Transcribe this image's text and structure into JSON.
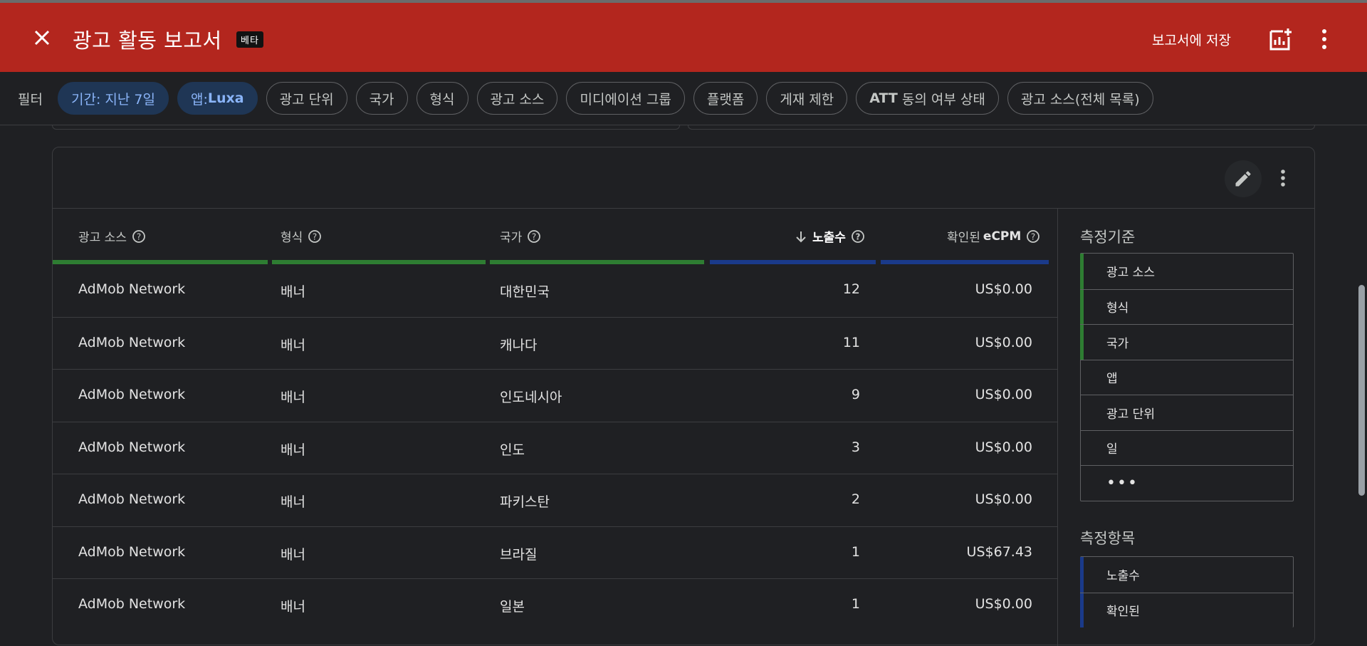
{
  "header": {
    "title": "광고 활동 보고서",
    "badge": "베타",
    "save_label": "보고서에 저장"
  },
  "filters": {
    "label": "필터",
    "chips": [
      {
        "label": "기간: 지난 7일",
        "active": true
      },
      {
        "label": "앱: Luxa",
        "active": true
      },
      {
        "label": "광고 단위",
        "active": false
      },
      {
        "label": "국가",
        "active": false
      },
      {
        "label": "형식",
        "active": false
      },
      {
        "label": "광고 소스",
        "active": false
      },
      {
        "label": "미디에이션 그룹",
        "active": false
      },
      {
        "label": "플랫폼",
        "active": false
      },
      {
        "label": "게재 제한",
        "active": false
      },
      {
        "label": "ATT 동의 여부 상태",
        "active": false
      },
      {
        "label": "광고 소스(전체 목록)",
        "active": false
      }
    ]
  },
  "table": {
    "columns": [
      {
        "label": "광고 소스",
        "type": "dimension"
      },
      {
        "label": "형식",
        "type": "dimension"
      },
      {
        "label": "국가",
        "type": "dimension"
      },
      {
        "label": "노출수",
        "type": "metric",
        "sorted": "desc"
      },
      {
        "label": "확인된",
        "label_bold": "eCPM",
        "type": "metric"
      }
    ],
    "rows": [
      [
        "AdMob Network",
        "배너",
        "대한민국",
        "12",
        "US$0.00"
      ],
      [
        "AdMob Network",
        "배너",
        "캐나다",
        "11",
        "US$0.00"
      ],
      [
        "AdMob Network",
        "배너",
        "인도네시아",
        "9",
        "US$0.00"
      ],
      [
        "AdMob Network",
        "배너",
        "인도",
        "3",
        "US$0.00"
      ],
      [
        "AdMob Network",
        "배너",
        "파키스탄",
        "2",
        "US$0.00"
      ],
      [
        "AdMob Network",
        "배너",
        "브라질",
        "1",
        "US$67.43"
      ],
      [
        "AdMob Network",
        "배너",
        "일본",
        "1",
        "US$0.00"
      ]
    ]
  },
  "sidebar": {
    "dimensions_title": "측정기준",
    "dimensions": [
      {
        "label": "광고 소스",
        "selected": true
      },
      {
        "label": "형식",
        "selected": true
      },
      {
        "label": "국가",
        "selected": true
      },
      {
        "label": "앱",
        "selected": false
      },
      {
        "label": "광고 단위",
        "selected": false
      },
      {
        "label": "일",
        "selected": false
      }
    ],
    "more_label": "•••",
    "metrics_title": "측정항목",
    "metrics": [
      {
        "label": "노출수",
        "selected": true
      },
      {
        "label": "확인된",
        "selected": true
      }
    ]
  },
  "colors": {
    "appbar": "#b3261e",
    "dimension_accent": "#2e7d32",
    "metric_accent": "#1a3a8a",
    "active_chip_text": "#8ab4f8"
  }
}
